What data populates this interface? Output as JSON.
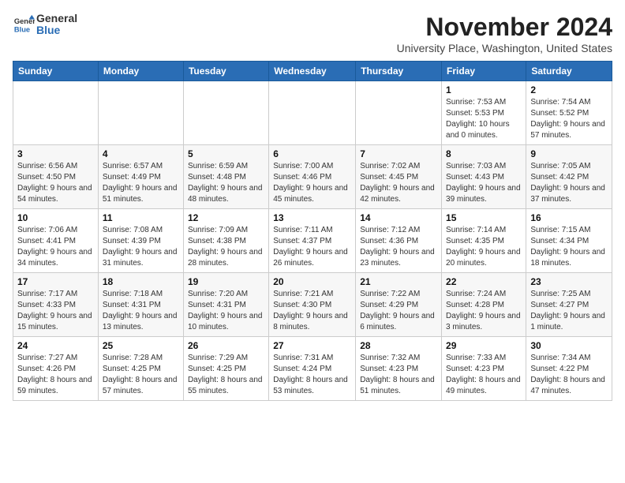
{
  "logo": {
    "general": "General",
    "blue": "Blue"
  },
  "title": "November 2024",
  "subtitle": "University Place, Washington, United States",
  "days_of_week": [
    "Sunday",
    "Monday",
    "Tuesday",
    "Wednesday",
    "Thursday",
    "Friday",
    "Saturday"
  ],
  "weeks": [
    [
      {
        "day": "",
        "detail": ""
      },
      {
        "day": "",
        "detail": ""
      },
      {
        "day": "",
        "detail": ""
      },
      {
        "day": "",
        "detail": ""
      },
      {
        "day": "",
        "detail": ""
      },
      {
        "day": "1",
        "detail": "Sunrise: 7:53 AM\nSunset: 5:53 PM\nDaylight: 10 hours and 0 minutes."
      },
      {
        "day": "2",
        "detail": "Sunrise: 7:54 AM\nSunset: 5:52 PM\nDaylight: 9 hours and 57 minutes."
      }
    ],
    [
      {
        "day": "3",
        "detail": "Sunrise: 6:56 AM\nSunset: 4:50 PM\nDaylight: 9 hours and 54 minutes."
      },
      {
        "day": "4",
        "detail": "Sunrise: 6:57 AM\nSunset: 4:49 PM\nDaylight: 9 hours and 51 minutes."
      },
      {
        "day": "5",
        "detail": "Sunrise: 6:59 AM\nSunset: 4:48 PM\nDaylight: 9 hours and 48 minutes."
      },
      {
        "day": "6",
        "detail": "Sunrise: 7:00 AM\nSunset: 4:46 PM\nDaylight: 9 hours and 45 minutes."
      },
      {
        "day": "7",
        "detail": "Sunrise: 7:02 AM\nSunset: 4:45 PM\nDaylight: 9 hours and 42 minutes."
      },
      {
        "day": "8",
        "detail": "Sunrise: 7:03 AM\nSunset: 4:43 PM\nDaylight: 9 hours and 39 minutes."
      },
      {
        "day": "9",
        "detail": "Sunrise: 7:05 AM\nSunset: 4:42 PM\nDaylight: 9 hours and 37 minutes."
      }
    ],
    [
      {
        "day": "10",
        "detail": "Sunrise: 7:06 AM\nSunset: 4:41 PM\nDaylight: 9 hours and 34 minutes."
      },
      {
        "day": "11",
        "detail": "Sunrise: 7:08 AM\nSunset: 4:39 PM\nDaylight: 9 hours and 31 minutes."
      },
      {
        "day": "12",
        "detail": "Sunrise: 7:09 AM\nSunset: 4:38 PM\nDaylight: 9 hours and 28 minutes."
      },
      {
        "day": "13",
        "detail": "Sunrise: 7:11 AM\nSunset: 4:37 PM\nDaylight: 9 hours and 26 minutes."
      },
      {
        "day": "14",
        "detail": "Sunrise: 7:12 AM\nSunset: 4:36 PM\nDaylight: 9 hours and 23 minutes."
      },
      {
        "day": "15",
        "detail": "Sunrise: 7:14 AM\nSunset: 4:35 PM\nDaylight: 9 hours and 20 minutes."
      },
      {
        "day": "16",
        "detail": "Sunrise: 7:15 AM\nSunset: 4:34 PM\nDaylight: 9 hours and 18 minutes."
      }
    ],
    [
      {
        "day": "17",
        "detail": "Sunrise: 7:17 AM\nSunset: 4:33 PM\nDaylight: 9 hours and 15 minutes."
      },
      {
        "day": "18",
        "detail": "Sunrise: 7:18 AM\nSunset: 4:31 PM\nDaylight: 9 hours and 13 minutes."
      },
      {
        "day": "19",
        "detail": "Sunrise: 7:20 AM\nSunset: 4:31 PM\nDaylight: 9 hours and 10 minutes."
      },
      {
        "day": "20",
        "detail": "Sunrise: 7:21 AM\nSunset: 4:30 PM\nDaylight: 9 hours and 8 minutes."
      },
      {
        "day": "21",
        "detail": "Sunrise: 7:22 AM\nSunset: 4:29 PM\nDaylight: 9 hours and 6 minutes."
      },
      {
        "day": "22",
        "detail": "Sunrise: 7:24 AM\nSunset: 4:28 PM\nDaylight: 9 hours and 3 minutes."
      },
      {
        "day": "23",
        "detail": "Sunrise: 7:25 AM\nSunset: 4:27 PM\nDaylight: 9 hours and 1 minute."
      }
    ],
    [
      {
        "day": "24",
        "detail": "Sunrise: 7:27 AM\nSunset: 4:26 PM\nDaylight: 8 hours and 59 minutes."
      },
      {
        "day": "25",
        "detail": "Sunrise: 7:28 AM\nSunset: 4:25 PM\nDaylight: 8 hours and 57 minutes."
      },
      {
        "day": "26",
        "detail": "Sunrise: 7:29 AM\nSunset: 4:25 PM\nDaylight: 8 hours and 55 minutes."
      },
      {
        "day": "27",
        "detail": "Sunrise: 7:31 AM\nSunset: 4:24 PM\nDaylight: 8 hours and 53 minutes."
      },
      {
        "day": "28",
        "detail": "Sunrise: 7:32 AM\nSunset: 4:23 PM\nDaylight: 8 hours and 51 minutes."
      },
      {
        "day": "29",
        "detail": "Sunrise: 7:33 AM\nSunset: 4:23 PM\nDaylight: 8 hours and 49 minutes."
      },
      {
        "day": "30",
        "detail": "Sunrise: 7:34 AM\nSunset: 4:22 PM\nDaylight: 8 hours and 47 minutes."
      }
    ]
  ]
}
